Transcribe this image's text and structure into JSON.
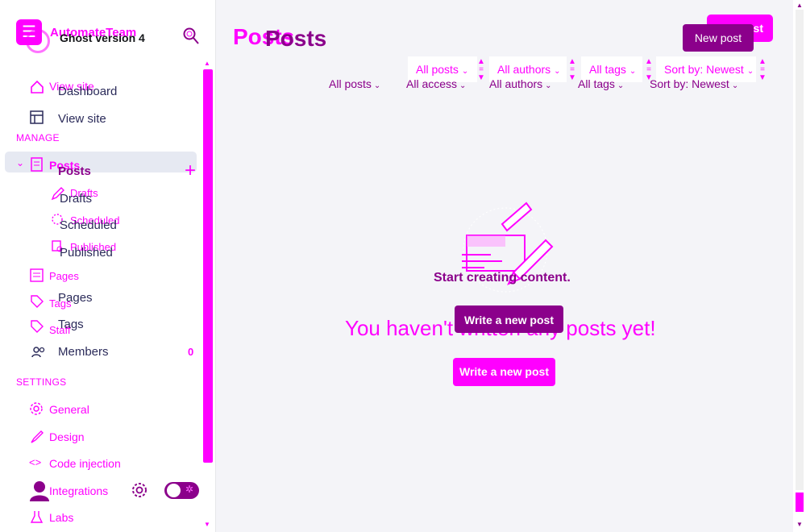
{
  "site": {
    "name": "AutomateTeam",
    "version": "Ghost version 4"
  },
  "sidebar": {
    "overlay_items": [
      {
        "label": "View site",
        "icon": "home-icon"
      },
      {
        "label": "Posts",
        "icon": "posts-icon"
      },
      {
        "label": "Drafts",
        "icon": "pencil-icon"
      },
      {
        "label": "Scheduled",
        "icon": "clock-icon"
      },
      {
        "label": "Published",
        "icon": "published-icon"
      },
      {
        "label": "Pages",
        "icon": "pages-icon"
      },
      {
        "label": "Tags",
        "icon": "tag-icon"
      },
      {
        "label": "Staff",
        "icon": "staff-icon"
      }
    ],
    "items": [
      {
        "label": "Dashboard"
      },
      {
        "label": "View site",
        "icon": "layout-icon"
      },
      {
        "label": "Posts"
      },
      {
        "label": "Drafts"
      },
      {
        "label": "Scheduled"
      },
      {
        "label": "Published"
      },
      {
        "label": "Pages"
      },
      {
        "label": "Tags"
      },
      {
        "label": "Members",
        "icon": "members-icon",
        "count": "0"
      }
    ],
    "manage_heading": "MANAGE",
    "settings_heading": "SETTINGS",
    "settings_items": [
      {
        "label": "General",
        "icon": "gear-icon"
      },
      {
        "label": "Design",
        "icon": "brush-icon"
      },
      {
        "label": "Code injection",
        "icon": "code-icon"
      },
      {
        "label": "Integrations",
        "icon": "integrations-icon"
      },
      {
        "label": "Labs",
        "icon": "flask-icon"
      }
    ]
  },
  "header": {
    "title": "Posts",
    "title_overlay": "Posts",
    "new_post_back": "New post",
    "new_post": "New post"
  },
  "filters": {
    "selects": [
      "All posts",
      "All authors",
      "All tags",
      "Sort by: Newest"
    ],
    "options": [
      "All posts",
      "All access",
      "All authors",
      "All tags",
      "Sort by: Newest"
    ]
  },
  "empty_state": {
    "heading": "Start creating content.",
    "write_button_a": "Write a new post",
    "message": "You haven't written any posts yet!",
    "write_button_b": "Write a new post"
  },
  "colors": {
    "accent": "#ff00ff",
    "accent_dark": "#8b008b",
    "bg": "#f4f4f8"
  }
}
